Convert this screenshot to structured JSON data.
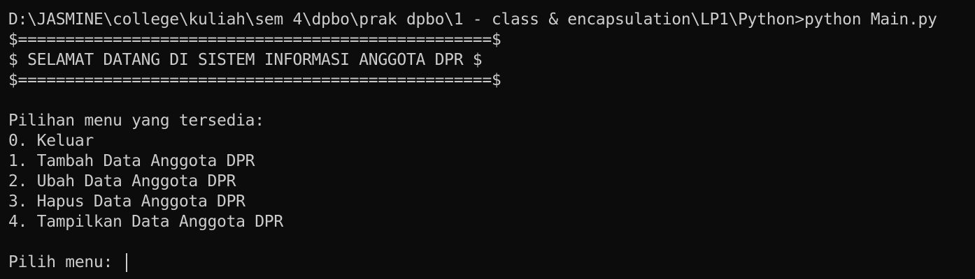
{
  "terminal": {
    "command_line": "D:\\JASMINE\\college\\kuliah\\sem 4\\dpbo\\prak dpbo\\1 - class & encapsulation\\LP1\\Python>python Main.py",
    "banner_top": "$==================================================$",
    "banner_title": "$ SELAMAT DATANG DI SISTEM INFORMASI ANGGOTA DPR $",
    "banner_bottom": "$==================================================$",
    "menu_heading": "Pilihan menu yang tersedia:",
    "menu_items": [
      "0. Keluar",
      "1. Tambah Data Anggota DPR",
      "2. Ubah Data Anggota DPR",
      "3. Hapus Data Anggota DPR",
      "4. Tampilkan Data Anggota DPR"
    ],
    "input_prompt": "Pilih menu: ",
    "input_value": ""
  }
}
